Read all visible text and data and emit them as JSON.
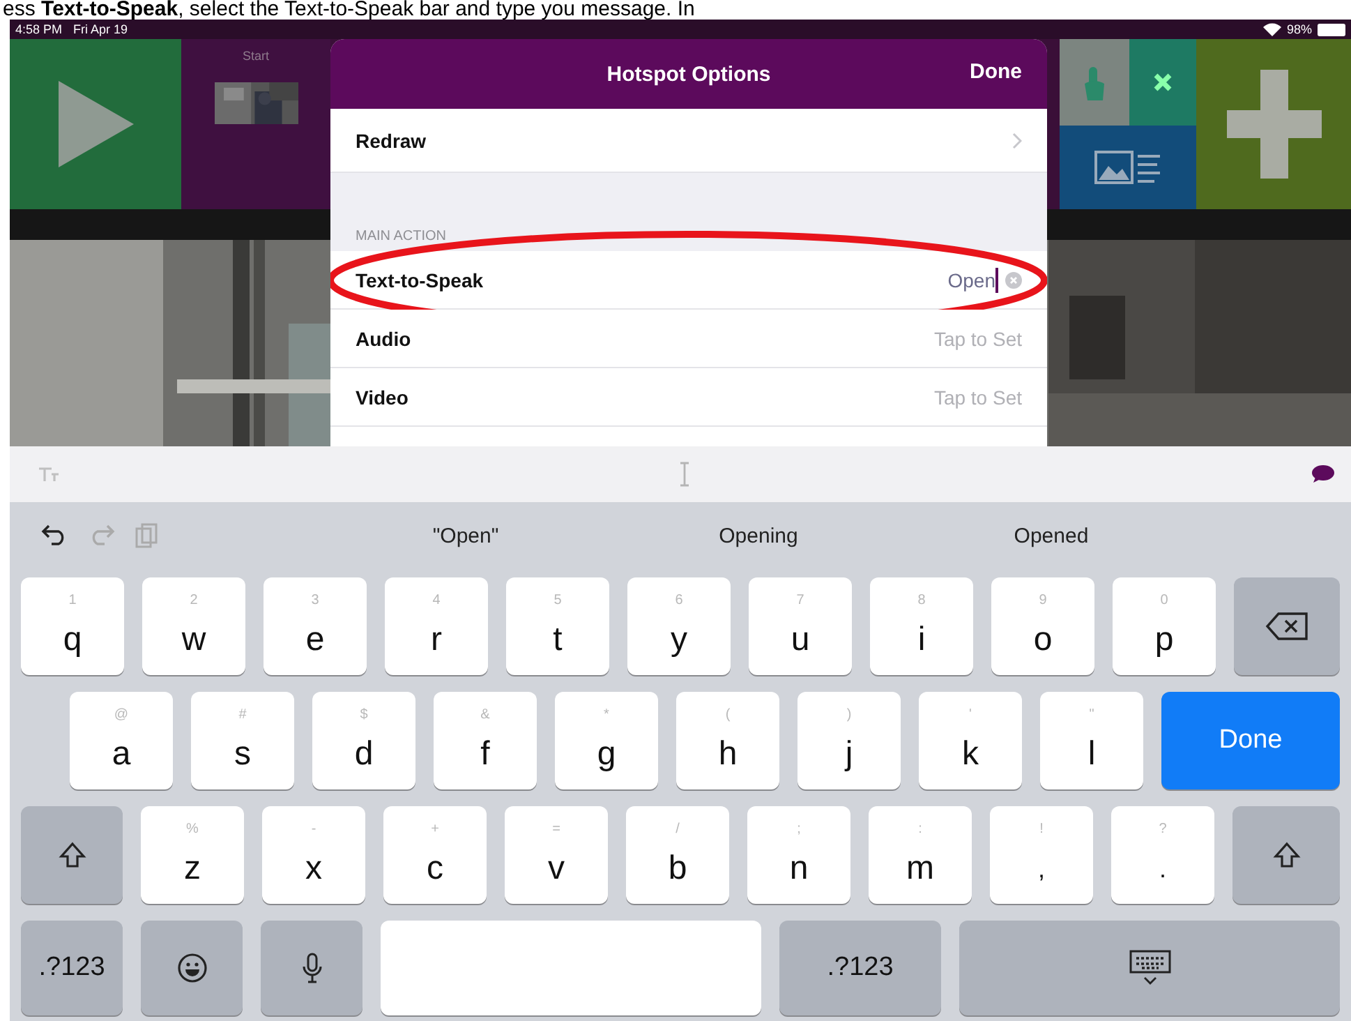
{
  "caption": "ess **Text-to-Speak**, select the Text-to-Speak bar and type you message. In",
  "status_bar": {
    "time": "4:58 PM",
    "date": "Fri Apr 19",
    "battery": "98%"
  },
  "app": {
    "start_label": "Start"
  },
  "sheet": {
    "title": "Hotspot Options",
    "done": "Done",
    "rows": [
      {
        "kind": "nav",
        "label": "Redraw"
      },
      {
        "kind": "section",
        "label": "MAIN ACTION"
      },
      {
        "kind": "field",
        "label": "Text-to-Speak",
        "value": "Open",
        "focused": true,
        "highlighted": true
      },
      {
        "kind": "value",
        "label": "Audio",
        "value": "Tap to Set"
      },
      {
        "kind": "value",
        "label": "Video",
        "value": "Tap to Set"
      }
    ]
  },
  "keyboard": {
    "suggestions": [
      "\"Open\"",
      "Opening",
      "Opened"
    ],
    "rows": [
      [
        {
          "kind": "letter",
          "label": "q",
          "alt": "1"
        },
        {
          "kind": "letter",
          "label": "w",
          "alt": "2"
        },
        {
          "kind": "letter",
          "label": "e",
          "alt": "3"
        },
        {
          "kind": "letter",
          "label": "r",
          "alt": "4"
        },
        {
          "kind": "letter",
          "label": "t",
          "alt": "5"
        },
        {
          "kind": "letter",
          "label": "y",
          "alt": "6"
        },
        {
          "kind": "letter",
          "label": "u",
          "alt": "7"
        },
        {
          "kind": "letter",
          "label": "i",
          "alt": "8"
        },
        {
          "kind": "letter",
          "label": "o",
          "alt": "9"
        },
        {
          "kind": "letter",
          "label": "p",
          "alt": "0"
        },
        {
          "kind": "backspace"
        }
      ],
      [
        {
          "kind": "letter",
          "label": "a",
          "alt": "@"
        },
        {
          "kind": "letter",
          "label": "s",
          "alt": "#"
        },
        {
          "kind": "letter",
          "label": "d",
          "alt": "$"
        },
        {
          "kind": "letter",
          "label": "f",
          "alt": "&"
        },
        {
          "kind": "letter",
          "label": "g",
          "alt": "*"
        },
        {
          "kind": "letter",
          "label": "h",
          "alt": "("
        },
        {
          "kind": "letter",
          "label": "j",
          "alt": ")"
        },
        {
          "kind": "letter",
          "label": "k",
          "alt": "'"
        },
        {
          "kind": "letter",
          "label": "l",
          "alt": "\""
        },
        {
          "kind": "action",
          "label": "Done"
        }
      ],
      [
        {
          "kind": "shift"
        },
        {
          "kind": "letter",
          "label": "z",
          "alt": "%"
        },
        {
          "kind": "letter",
          "label": "x",
          "alt": "-"
        },
        {
          "kind": "letter",
          "label": "c",
          "alt": "+"
        },
        {
          "kind": "letter",
          "label": "v",
          "alt": "="
        },
        {
          "kind": "letter",
          "label": "b",
          "alt": "/"
        },
        {
          "kind": "letter",
          "label": "n",
          "alt": ";"
        },
        {
          "kind": "letter",
          "label": "m",
          "alt": ":"
        },
        {
          "kind": "punct",
          "label": ",",
          "alt": "!"
        },
        {
          "kind": "punct",
          "label": ".",
          "alt": "?"
        },
        {
          "kind": "shift"
        }
      ],
      [
        {
          "kind": "mode",
          "label": ".?123"
        },
        {
          "kind": "emoji"
        },
        {
          "kind": "dictation"
        },
        {
          "kind": "space"
        },
        {
          "kind": "mode",
          "label": ".?123"
        },
        {
          "kind": "hide"
        }
      ]
    ]
  }
}
